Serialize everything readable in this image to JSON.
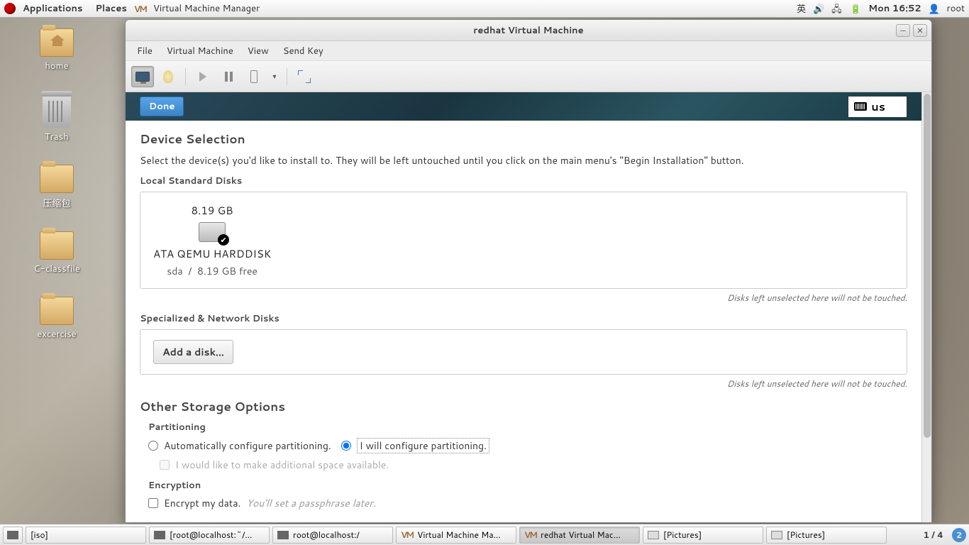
{
  "top_panel": {
    "applications": "Applications",
    "places": "Places",
    "app_title": "Virtual Machine Manager",
    "ime": "英",
    "clock": "Mon 16:52",
    "user": "root"
  },
  "desktop": {
    "home": "home",
    "trash": "Trash",
    "folder1": "压缩包",
    "folder2": "C-classfile",
    "folder3": "excercise"
  },
  "vm_window": {
    "title": "redhat Virtual Machine",
    "menu": {
      "file": "File",
      "vm": "Virtual Machine",
      "view": "View",
      "sendkey": "Send Key"
    }
  },
  "anaconda": {
    "done": "Done",
    "kbd_layout": "us",
    "section_title": "Device Selection",
    "section_desc": "Select the device(s) you'd like to install to.  They will be left untouched until you click on the main menu's \"Begin Installation\" button.",
    "local_disks": "Local Standard Disks",
    "disk": {
      "size": "8.19 GB",
      "name": "ATA QEMU HARDDISK",
      "dev": "sda",
      "sep": "/",
      "free": "8.19 GB free"
    },
    "note": "Disks left unselected here will not be touched.",
    "network_disks": "Specialized & Network Disks",
    "add_disk": "Add a disk...",
    "other_storage": "Other Storage Options",
    "partitioning": "Partitioning",
    "auto_part": "Automatically configure partitioning.",
    "manual_part": "I will configure partitioning.",
    "make_space": "I would like to make additional space available.",
    "encryption": "Encryption",
    "encrypt_data": "Encrypt my data.",
    "encrypt_hint": "You'll set a passphrase later."
  },
  "taskbar": {
    "t0": "[iso]",
    "t1": "[root@localhost:~/...",
    "t2": "root@localhost:/",
    "t3": "Virtual Machine Ma...",
    "t4": "redhat Virtual Mac...",
    "t5": "[Pictures]",
    "t6": "[Pictures]",
    "workspace": "1 / 4",
    "badge": "2"
  }
}
